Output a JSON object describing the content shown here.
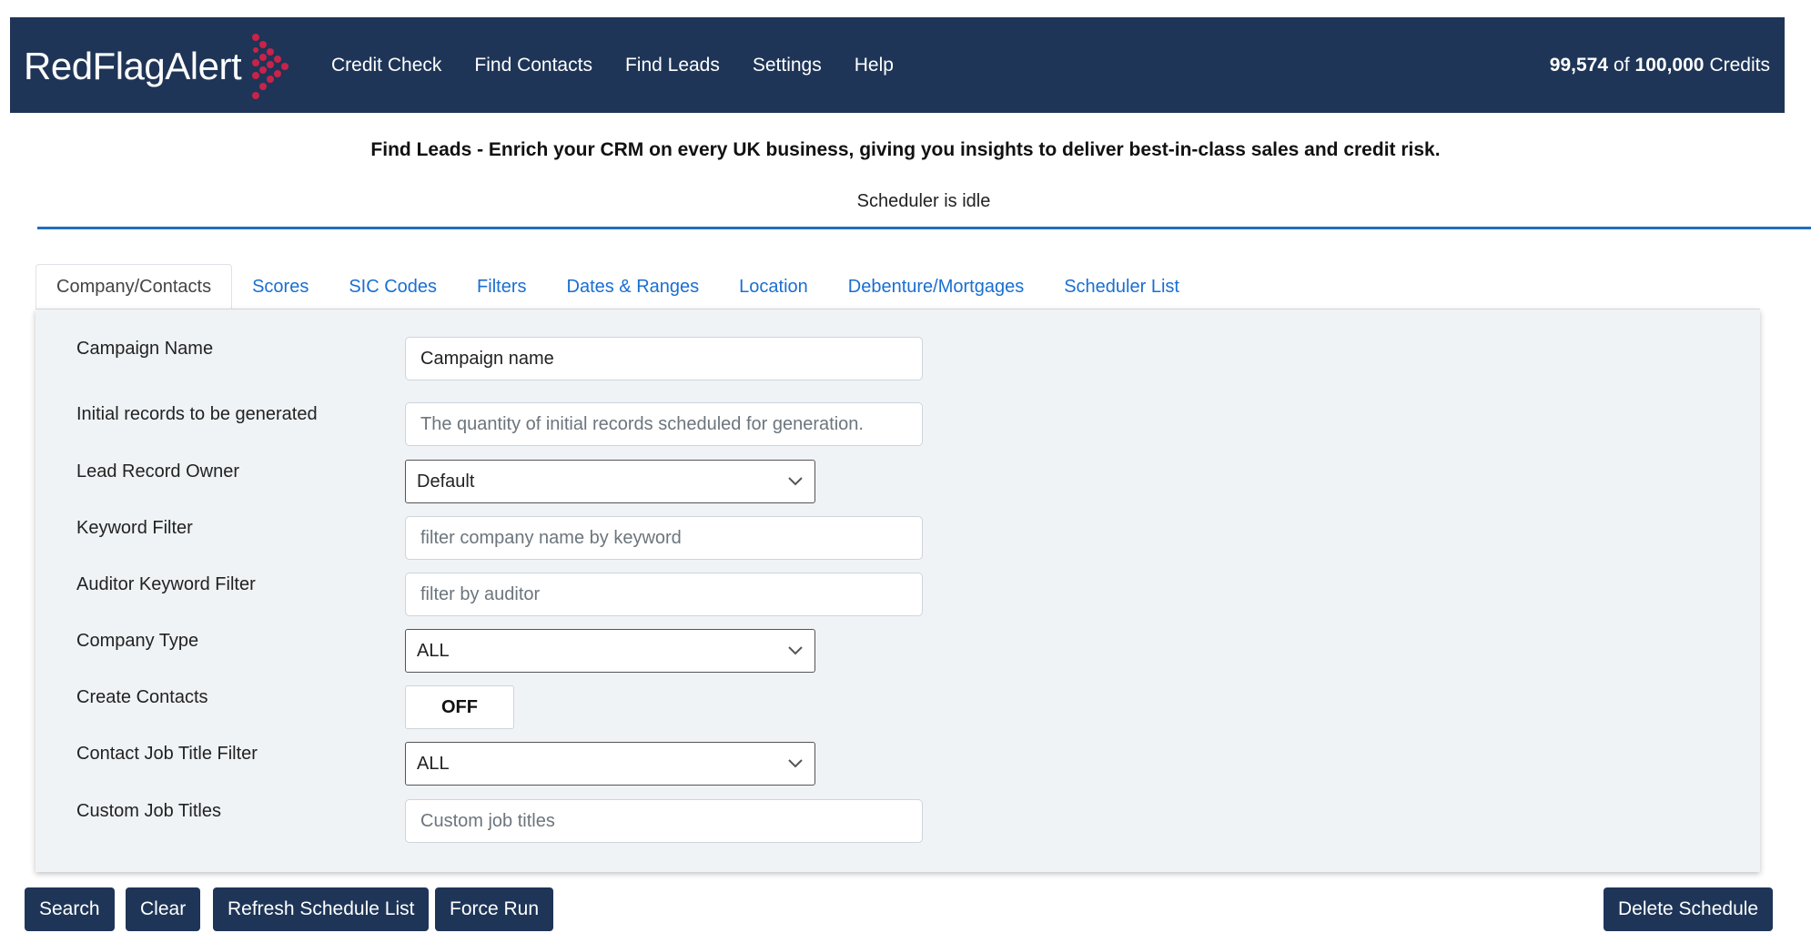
{
  "brand": {
    "name": "RedFlagAlert",
    "colors": {
      "navbar": "#1e3557",
      "accent": "#c8234a",
      "link": "#1a6fd1",
      "divider": "#1f6fbf"
    }
  },
  "nav": {
    "items": [
      "Credit Check",
      "Find Contacts",
      "Find Leads",
      "Settings",
      "Help"
    ]
  },
  "credits": {
    "used": "99,574",
    "of": "of",
    "total": "100,000",
    "unit": "Credits"
  },
  "headline": "Find Leads - Enrich your CRM on every UK business, giving you insights to deliver best-in-class sales and credit risk.",
  "status": "Scheduler is idle",
  "tabs": [
    "Company/Contacts",
    "Scores",
    "SIC Codes",
    "Filters",
    "Dates & Ranges",
    "Location",
    "Debenture/Mortgages",
    "Scheduler List"
  ],
  "form": {
    "campaign_name": {
      "label": "Campaign Name",
      "value": "Campaign name"
    },
    "initial_records": {
      "label": "Initial records to be generated",
      "placeholder": "The quantity of initial records scheduled for generation."
    },
    "lead_record_owner": {
      "label": "Lead Record Owner",
      "value": "Default"
    },
    "keyword_filter": {
      "label": "Keyword Filter",
      "placeholder": "filter company name by keyword"
    },
    "auditor_keyword_filter": {
      "label": "Auditor Keyword Filter",
      "placeholder": "filter by auditor"
    },
    "company_type": {
      "label": "Company Type",
      "value": "ALL"
    },
    "create_contacts": {
      "label": "Create Contacts",
      "value": "OFF"
    },
    "contact_job_title_filter": {
      "label": "Contact Job Title Filter",
      "value": "ALL"
    },
    "custom_job_titles": {
      "label": "Custom Job Titles",
      "placeholder": "Custom job titles"
    }
  },
  "buttons": {
    "search": "Search",
    "clear": "Clear",
    "refresh": "Refresh Schedule List",
    "force_run": "Force Run",
    "delete": "Delete Schedule"
  }
}
